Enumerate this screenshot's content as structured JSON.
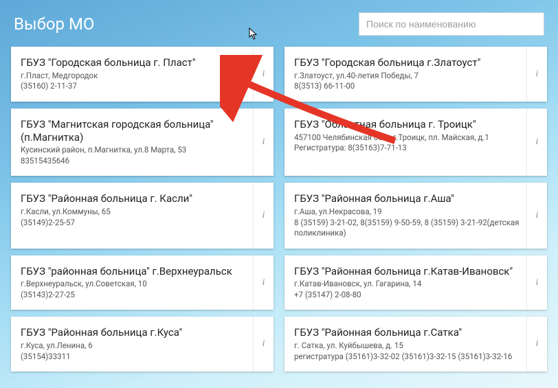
{
  "header": {
    "title": "Выбор МО",
    "search_placeholder": "Поиск по наименованию"
  },
  "info_icon": "i",
  "cards": [
    {
      "name": "ГБУЗ \"Городская больница г. Пласт\"",
      "lines": [
        "г.Пласт, Медгородок",
        "(35160) 2-11-37"
      ]
    },
    {
      "name": "ГБУЗ \"Городская больница г.Златоуст\"",
      "lines": [
        "г.Златоуст, ул.40-летия Победы, 7",
        "8(3513) 66-11-00"
      ]
    },
    {
      "name": "ГБУЗ \"Магнитская городская больница\" (п.Магнитка)",
      "lines": [
        "Кусинский район, п.Магнитка, ул.8 Марта, 53",
        "83515435646"
      ]
    },
    {
      "name": "ГБУЗ \"Областная больница г. Троицк\"",
      "lines": [
        "457100 Челябинская обл., г.Троицк, пл. Майская, д.1",
        "Регистратура: 8(35163)7-71-13"
      ]
    },
    {
      "name": "ГБУЗ \"Районная больница г. Касли\"",
      "lines": [
        "г.Касли, ул.Коммуны, 65",
        "(35149)2-25-57"
      ]
    },
    {
      "name": "ГБУЗ \"Районная больница г.Аша\"",
      "lines": [
        "г.Аша, ул.Некрасова, 19",
        "8 (35159) 3-21-02, 8(35159) 9-50-59, 8 (35159) 3-21-92(детская поликлиника)"
      ]
    },
    {
      "name": "ГБУЗ \"районная больница\" г.Верхнеуральск",
      "lines": [
        "г.Верхнеуральск, ул.Советская, 10",
        "(35143)2-27-25"
      ]
    },
    {
      "name": "ГБУЗ \"Районная больница г.Катав-Ивановск\"",
      "lines": [
        "г.Катав-Ивановск, ул. Гагарина, 14",
        "+7 (35147) 2-08-80"
      ]
    },
    {
      "name": "ГБУЗ \"Районная больница г.Куса\"",
      "lines": [
        "г.Куса, ул.Ленина, 6",
        "(35154)33311"
      ]
    },
    {
      "name": "ГБУЗ \"Районная больница г.Сатка\"",
      "lines": [
        "г. Сатка, ул. Куйбышева, д. 15",
        "регистратура (35161)3-32-02 (35161)3-32-15 (35161)3-32-16"
      ]
    }
  ]
}
